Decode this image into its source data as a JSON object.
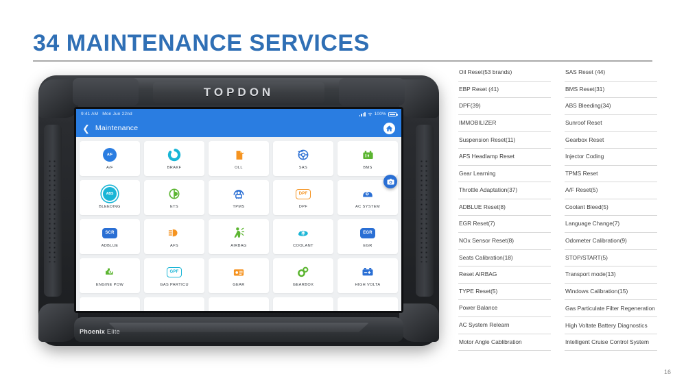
{
  "slide": {
    "title": "34 MAINTENANCE SERVICES",
    "page_number": "16",
    "accent_color": "#2f6fb5"
  },
  "device": {
    "brand": "TOPDON",
    "model_bold": "Phoenix",
    "model_light": "Elite",
    "screen": {
      "status_bar": {
        "time": "9:41 AM",
        "date": "Mon Jun 22nd",
        "battery": "100%",
        "signal_icon": "signal-bars-icon",
        "wifi_icon": "wifi-icon",
        "battery_icon": "battery-icon"
      },
      "app_bar": {
        "back_icon": "chevron-left-icon",
        "title": "Maintenance",
        "home_icon": "home-icon"
      },
      "fab_icon": "camera-icon",
      "tiles": [
        {
          "label": "A/F",
          "icon": "af-icon",
          "glyph": "A/F",
          "shape": "circle",
          "color": "#2a7de1"
        },
        {
          "label": "BRAKF",
          "icon": "brake-icon",
          "glyph": "",
          "shape": "svg",
          "color": "#19b5d6"
        },
        {
          "label": "OLL",
          "icon": "oil-bottle-icon",
          "glyph": "",
          "shape": "svg",
          "color": "#f59320"
        },
        {
          "label": "SAS",
          "icon": "steering-angle-icon",
          "glyph": "",
          "shape": "svg",
          "color": "#2a6fd4"
        },
        {
          "label": "BMS",
          "icon": "battery-green-icon",
          "glyph": "",
          "shape": "svg",
          "color": "#5cb531"
        },
        {
          "label": "BLEEDING",
          "icon": "abs-bleeding-icon",
          "glyph": "ABS",
          "shape": "circle",
          "color": "#19b5d6"
        },
        {
          "label": "ETS",
          "icon": "ets-icon",
          "glyph": "",
          "shape": "svg",
          "color": "#5cb531"
        },
        {
          "label": "TPMS",
          "icon": "tpms-icon",
          "glyph": "",
          "shape": "svg",
          "color": "#2a6fd4"
        },
        {
          "label": "DPF",
          "icon": "dpf-icon",
          "glyph": "DPF",
          "shape": "badge",
          "color": "#f59320"
        },
        {
          "label": "AC SYSTEM",
          "icon": "ac-system-icon",
          "glyph": "",
          "shape": "svg",
          "color": "#2a6fd4"
        },
        {
          "label": "ADBLUE",
          "icon": "scr-icon",
          "glyph": "SCR",
          "shape": "badge",
          "color": "#2a6fd4"
        },
        {
          "label": "AFS",
          "icon": "headlamp-icon",
          "glyph": "",
          "shape": "svg",
          "color": "#f59320"
        },
        {
          "label": "AIRBAG",
          "icon": "airbag-icon",
          "glyph": "",
          "shape": "svg",
          "color": "#5cb531"
        },
        {
          "label": "COOLANT",
          "icon": "coolant-icon",
          "glyph": "",
          "shape": "svg",
          "color": "#19b5d6"
        },
        {
          "label": "EGR",
          "icon": "egr-icon",
          "glyph": "EGR",
          "shape": "badge",
          "color": "#2a6fd4"
        },
        {
          "label": "ENGINE POW",
          "icon": "engine-icon",
          "glyph": "",
          "shape": "svg",
          "color": "#5cb531"
        },
        {
          "label": "GAS PARTICU",
          "icon": "gpf-icon",
          "glyph": "GPF",
          "shape": "badge",
          "color": "#19b5d6"
        },
        {
          "label": "GEAR",
          "icon": "gear-card-icon",
          "glyph": "",
          "shape": "svg",
          "color": "#f59320"
        },
        {
          "label": "GEARBOX",
          "icon": "gearbox-icon",
          "glyph": "",
          "shape": "svg",
          "color": "#5cb531"
        },
        {
          "label": "HIGH VOLTA",
          "icon": "hv-battery-icon",
          "glyph": "",
          "shape": "svg",
          "color": "#2a6fd4"
        }
      ]
    }
  },
  "services": {
    "left_column": [
      "Oil Reset(53 brands)",
      "EBP Reset (41)",
      "DPF(39)",
      "IMMOBILIZER",
      "Suspension Reset(11)",
      "AFS Headlamp Reset",
      "Gear Learning",
      "Throttle Adaptation(37)",
      "ADBLUE Reset(8)",
      "EGR Reset(7)",
      "NOx Sensor Reset(8)",
      "Seats Calibration(18)",
      "Reset AIRBAG",
      "TYPE Reset(5)",
      "Power Balance",
      "AC System Relearn",
      "Motor Angle Cablibration"
    ],
    "right_column": [
      "SAS Reset (44)",
      "BMS Reset(31)",
      "ABS Bleeding(34)",
      "Sunroof Reset",
      "Gearbox Reset",
      "Injector Coding",
      "TPMS Reset",
      "A/F Reset(5)",
      "Coolant Bleed(5)",
      "Language Change(7)",
      "Odometer Calibration(9)",
      "STOP/START(5)",
      "Transport mode(13)",
      "Windows Calibration(15)",
      "Gas Particulate Filter Regeneration",
      "High Voltate Battery Diagnostics",
      "Intelligent Cruise Control System"
    ]
  }
}
